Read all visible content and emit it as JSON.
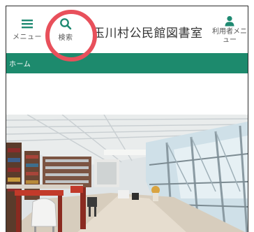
{
  "header": {
    "menu_label": "メニュー",
    "search_label": "検索",
    "title": "玉川村公民館図書室",
    "user_menu_label": "利用者メニュー"
  },
  "breadcrumb": {
    "home": "ホーム"
  },
  "icons": {
    "menu": "hamburger-icon",
    "search": "magnifier-icon",
    "user": "person-icon"
  },
  "colors": {
    "accent": "#1d8a6d",
    "icon": "#1f8a72",
    "highlight": "#e8505b"
  }
}
